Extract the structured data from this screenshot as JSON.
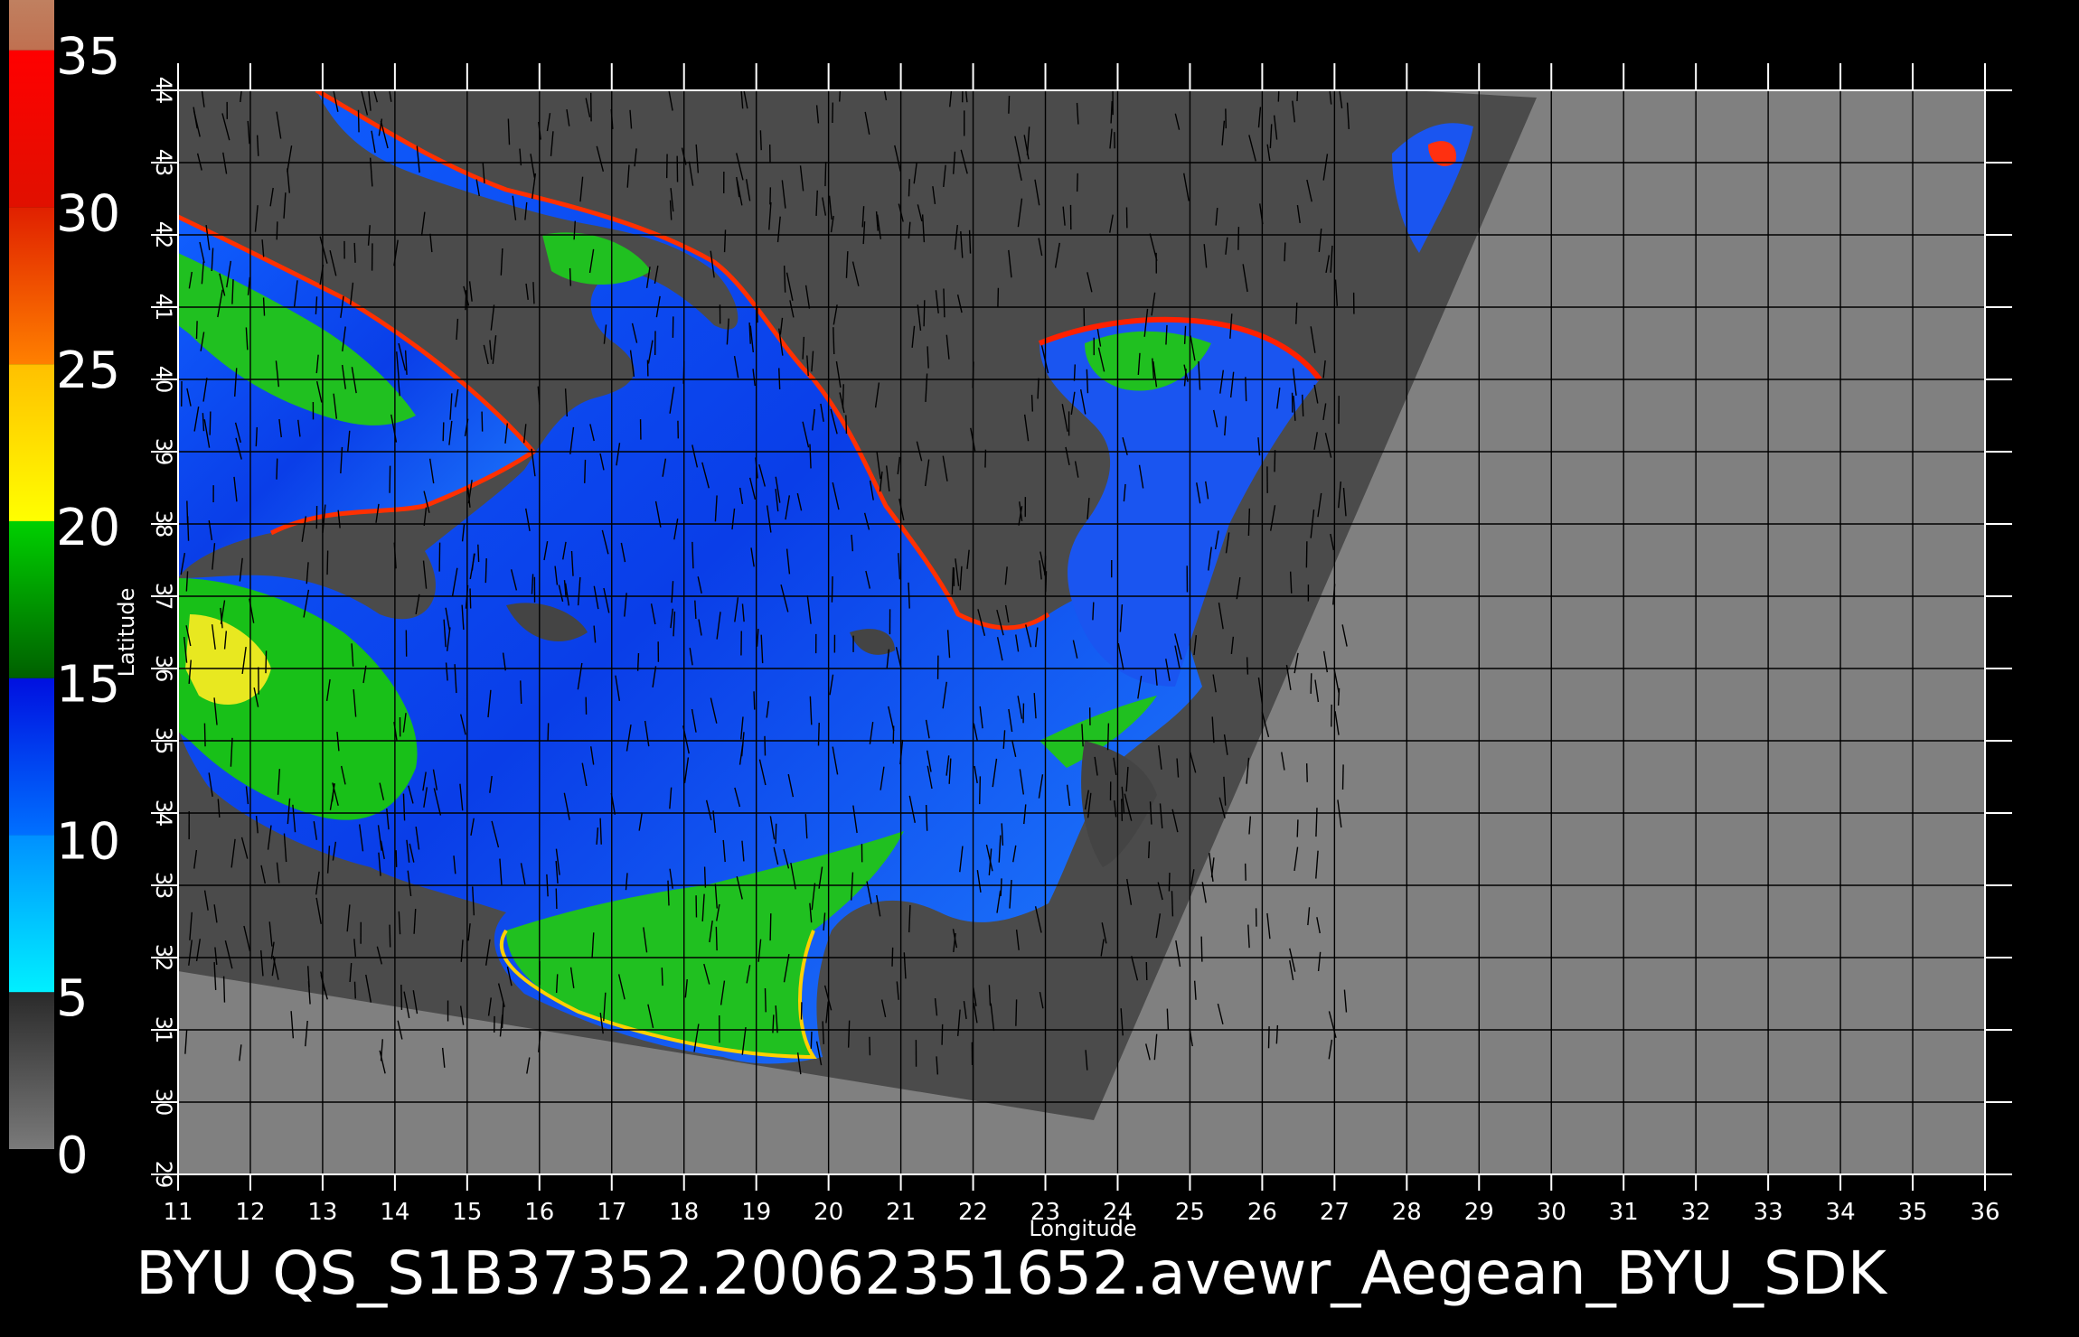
{
  "title": "BYU  QS_S1B37352.20062351652.avewr_Aegean_BYU_SDK",
  "axes": {
    "xlabel": "Longitude",
    "ylabel": "Latitude",
    "x_ticks": [
      "11",
      "12",
      "13",
      "14",
      "15",
      "16",
      "17",
      "18",
      "19",
      "20",
      "21",
      "22",
      "23",
      "24",
      "25",
      "26",
      "27",
      "28",
      "29",
      "30",
      "31",
      "32",
      "33",
      "34",
      "35",
      "36"
    ],
    "y_ticks": [
      "29",
      "30",
      "31",
      "32",
      "33",
      "34",
      "35",
      "36",
      "37",
      "38",
      "39",
      "40",
      "41",
      "42",
      "43",
      "44"
    ]
  },
  "colorbar": {
    "labels": [
      "0",
      "5",
      "10",
      "15",
      "20",
      "25",
      "30",
      "35"
    ],
    "segments": [
      {
        "from": 0,
        "to": 5,
        "top": "#2a2a2a",
        "bottom": "#7a7a7a"
      },
      {
        "from": 5,
        "to": 10,
        "top": "#0090ff",
        "bottom": "#00f0ff"
      },
      {
        "from": 10,
        "to": 15,
        "top": "#0010e0",
        "bottom": "#0070ff"
      },
      {
        "from": 15,
        "to": 20,
        "top": "#00d000",
        "bottom": "#006000"
      },
      {
        "from": 20,
        "to": 25,
        "top": "#ffc000",
        "bottom": "#ffff00"
      },
      {
        "from": 25,
        "to": 30,
        "top": "#e02000",
        "bottom": "#ff8000"
      },
      {
        "from": 30,
        "to": 35,
        "top": "#ff0000",
        "bottom": "#e01000"
      },
      {
        "from": 35,
        "to": 37,
        "top": "#c08060",
        "bottom": "#c07050"
      }
    ]
  },
  "colors": {
    "background": "#000000",
    "no_data": "#808080",
    "land": "#4b4b4b",
    "grid": "#000000",
    "text": "#ffffff"
  },
  "map": {
    "lon_range": [
      11,
      36
    ],
    "lat_range": [
      29,
      44
    ]
  }
}
